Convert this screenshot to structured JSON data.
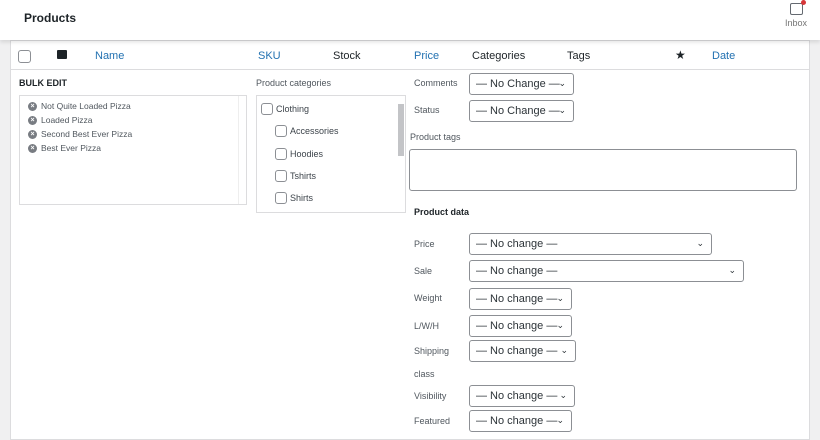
{
  "header": {
    "title": "Products",
    "inbox_label": "Inbox",
    "inbox_icon": "inbox-icon",
    "notification_color": "#d63638"
  },
  "columns": {
    "name": "Name",
    "sku": "SKU",
    "stock": "Stock",
    "price": "Price",
    "categories": "Categories",
    "tags": "Tags",
    "featured_icon": "star-icon",
    "date": "Date"
  },
  "bulk_edit": {
    "title": "BULK EDIT",
    "items": [
      "Not Quite Loaded Pizza",
      "Loaded Pizza",
      "Second Best Ever Pizza",
      "Best Ever Pizza"
    ]
  },
  "categories": {
    "label": "Product categories",
    "items": [
      {
        "label": "Clothing",
        "level": 0
      },
      {
        "label": "Accessories",
        "level": 1
      },
      {
        "label": "Hoodies",
        "level": 1
      },
      {
        "label": "Tshirts",
        "level": 1
      },
      {
        "label": "Shirts",
        "level": 1
      }
    ]
  },
  "fields": {
    "comments_label": "Comments",
    "comments_value": "— No Change —",
    "status_label": "Status",
    "status_value": "— No Change —",
    "tags_label": "Product tags",
    "tags_value": ""
  },
  "product_data": {
    "title": "Product data",
    "price_label": "Price",
    "price_value": "— No change —",
    "sale_label": "Sale",
    "sale_value": "— No change —",
    "weight_label": "Weight",
    "weight_value": "— No change —",
    "lwh_label": "L/W/H",
    "lwh_value": "— No change —",
    "shipping_label": "Shipping",
    "shipping_label2": "class",
    "shipping_value": "— No change —",
    "visibility_label": "Visibility",
    "visibility_value": "— No change —",
    "featured_label": "Featured",
    "featured_value": "— No change —"
  },
  "accent": "#2271b1"
}
